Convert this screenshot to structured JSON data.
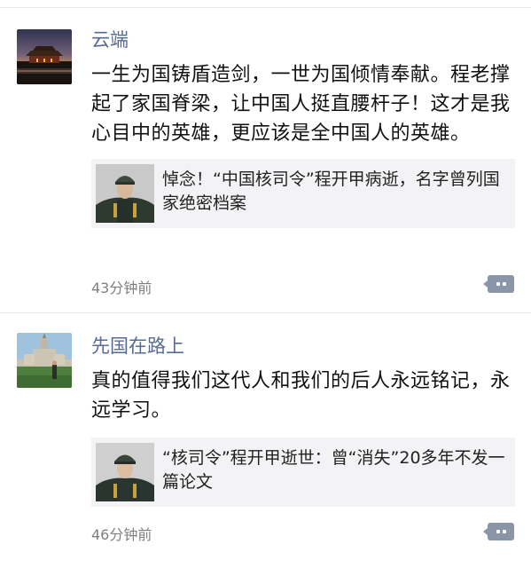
{
  "posts": [
    {
      "name": "云端",
      "text": "一生为国铸盾造剑，一世为国倾情奉献。程老撑起了家国脊梁，让中国人挺直腰杆子！这才是我心目中的英雄，更应该是全中国人的英雄。",
      "share_title": "悼念！“中国核司令”程开甲病逝，名字曾列国家绝密档案",
      "time": "43分钟前"
    },
    {
      "name": "先国在路上",
      "text": "真的值得我们这代人和我们的后人永远铭记，永远学习。",
      "share_title": "“核司令”程开甲逝世：曾“消失”20多年不发一篇论文",
      "time": "46分钟前"
    }
  ],
  "icons": {
    "comment": "comment-icon"
  },
  "colors": {
    "name": "#576b95",
    "share_bg": "#f3f3f5",
    "time": "#7f7f7f",
    "comment_button": "#8a96a8"
  }
}
